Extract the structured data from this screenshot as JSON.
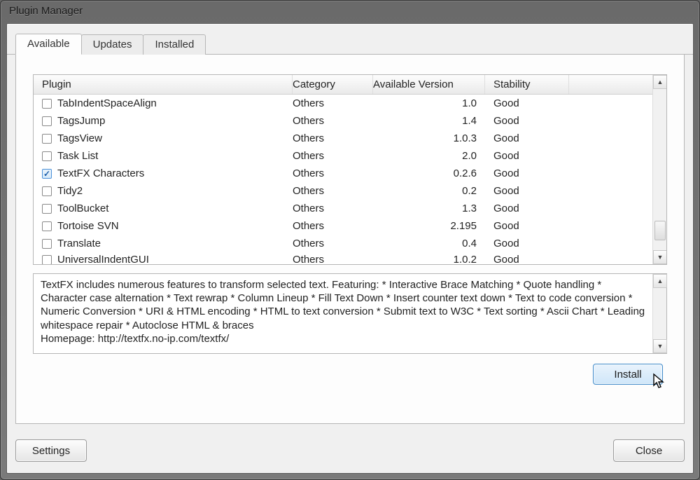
{
  "window": {
    "title": "Plugin Manager"
  },
  "tabs": {
    "available": "Available",
    "updates": "Updates",
    "installed": "Installed"
  },
  "columns": {
    "plugin": "Plugin",
    "category": "Category",
    "version": "Available Version",
    "stability": "Stability"
  },
  "plugins": [
    {
      "name": "TabIndentSpaceAlign",
      "category": "Others",
      "version": "1.0",
      "stability": "Good",
      "checked": false
    },
    {
      "name": "TagsJump",
      "category": "Others",
      "version": "1.4",
      "stability": "Good",
      "checked": false
    },
    {
      "name": "TagsView",
      "category": "Others",
      "version": "1.0.3",
      "stability": "Good",
      "checked": false
    },
    {
      "name": "Task List",
      "category": "Others",
      "version": "2.0",
      "stability": "Good",
      "checked": false
    },
    {
      "name": "TextFX Characters",
      "category": "Others",
      "version": "0.2.6",
      "stability": "Good",
      "checked": true
    },
    {
      "name": "Tidy2",
      "category": "Others",
      "version": "0.2",
      "stability": "Good",
      "checked": false
    },
    {
      "name": "ToolBucket",
      "category": "Others",
      "version": "1.3",
      "stability": "Good",
      "checked": false
    },
    {
      "name": "Tortoise SVN",
      "category": "Others",
      "version": "2.195",
      "stability": "Good",
      "checked": false
    },
    {
      "name": "Translate",
      "category": "Others",
      "version": "0.4",
      "stability": "Good",
      "checked": false
    },
    {
      "name": "UniversalIndentGUI",
      "category": "Others",
      "version": "1.0.2",
      "stability": "Good",
      "checked": false
    }
  ],
  "description": "TextFX includes numerous features to transform selected text. Featuring: * Interactive Brace Matching * Quote handling * Character case alternation * Text rewrap * Column Lineup * Fill Text Down * Insert counter text down * Text to code conversion * Numeric Conversion * URI & HTML encoding * HTML to text conversion * Submit text to W3C * Text sorting * Ascii Chart * Leading whitespace repair * Autoclose HTML & braces\nHomepage: http://textfx.no-ip.com/textfx/",
  "buttons": {
    "install": "Install",
    "settings": "Settings",
    "close": "Close"
  }
}
